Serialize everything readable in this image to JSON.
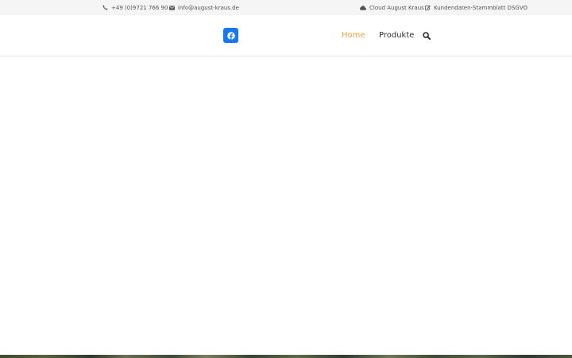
{
  "topbar": {
    "phone": "+49 (0)9721 766 90",
    "email": "info@august-kraus.de",
    "cloud_link": "Cloud August Kraus",
    "form_link": "Kundendaten-Stammblatt DSGVO"
  },
  "header": {
    "social_icon": "facebook-icon",
    "nav": {
      "home": "Home",
      "products": "Produkte"
    },
    "search_icon": "search-icon"
  },
  "colors": {
    "active_nav": "#f2a33a",
    "facebook": "#1877f2",
    "topbar_bg": "#f5f5f5"
  }
}
